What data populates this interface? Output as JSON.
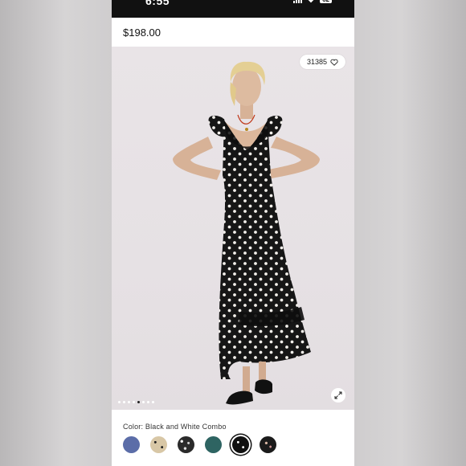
{
  "status_bar": {
    "time": "6:55",
    "battery": "62"
  },
  "product": {
    "price": "$198.00",
    "likes": "31385"
  },
  "gallery": {
    "dot_count": 8,
    "active_index": 4
  },
  "color": {
    "label": "Color: Black and White Combo",
    "swatches": [
      {
        "name": "blue",
        "hex": "#5b6da8"
      },
      {
        "name": "tan polka dot",
        "hex": "#d8c7a6"
      },
      {
        "name": "black and white print",
        "hex": "#2a2a2a"
      },
      {
        "name": "teal",
        "hex": "#2e6462"
      },
      {
        "name": "black and white combo",
        "hex": "#111111",
        "selected": true
      },
      {
        "name": "black multi dot",
        "hex": "#1b1b1b"
      }
    ]
  }
}
